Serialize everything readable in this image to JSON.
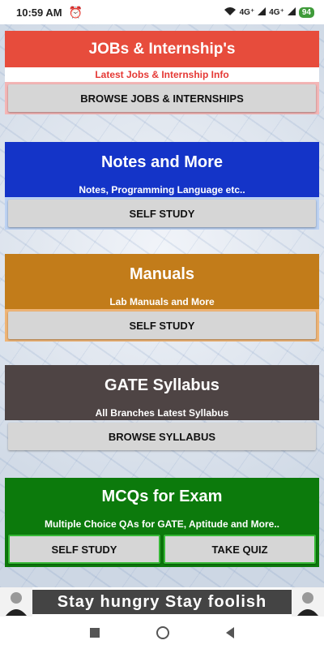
{
  "status_bar": {
    "time": "10:59 AM",
    "network1": "4G⁺",
    "network2": "4G⁺",
    "battery": "94"
  },
  "cards": [
    {
      "title": "JOBs & Internship's",
      "subtitle": "Latest Jobs & Internship Info",
      "buttons": [
        "BROWSE JOBS & INTERNSHIPS"
      ]
    },
    {
      "title": "Notes and More",
      "subtitle": "Notes, Programming Language etc..",
      "buttons": [
        "SELF STUDY"
      ]
    },
    {
      "title": "Manuals",
      "subtitle": "Lab Manuals and More",
      "buttons": [
        "SELF STUDY"
      ]
    },
    {
      "title": "GATE Syllabus",
      "subtitle": "All Branches Latest Syllabus",
      "buttons": [
        "BROWSE SYLLABUS"
      ]
    },
    {
      "title": "MCQs for Exam",
      "subtitle": "Multiple Choice QAs for GATE, Aptitude and More..",
      "buttons": [
        "SELF STUDY",
        "TAKE QUIZ"
      ]
    }
  ],
  "banner": {
    "quote": "Stay hungry Stay foolish"
  },
  "colors": {
    "jobs": "#e74c3c",
    "notes": "#1434c8",
    "manuals": "#c27c1a",
    "gate": "#4e4444",
    "mcq": "#0c7a0c"
  }
}
